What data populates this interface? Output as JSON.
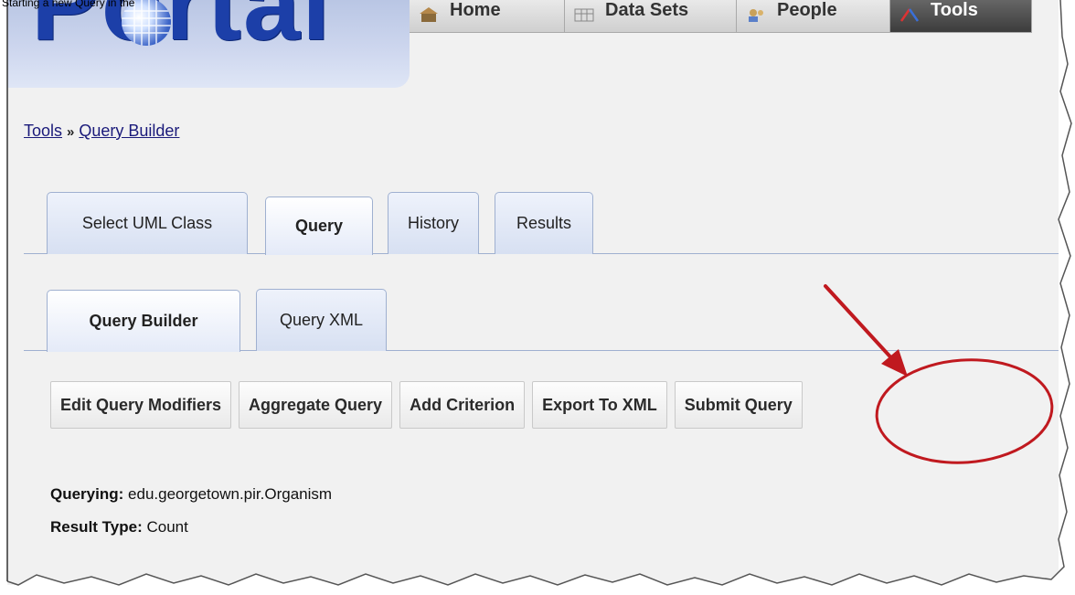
{
  "caption": "Starting a new Query in the",
  "logo": {
    "text": "Portal"
  },
  "topnav": [
    {
      "label": "Home",
      "icon": "home-icon",
      "active": false
    },
    {
      "label": "Data Sets",
      "icon": "datasets-icon",
      "active": false
    },
    {
      "label": "People",
      "icon": "people-icon",
      "active": false
    },
    {
      "label": "Tools",
      "icon": "tools-icon",
      "active": true
    }
  ],
  "breadcrumb": {
    "root": "Tools",
    "separator": "»",
    "current": "Query Builder"
  },
  "main_tabs": [
    {
      "label": "Select UML Class",
      "active": false
    },
    {
      "label": "Query",
      "active": true
    },
    {
      "label": "History",
      "active": false
    },
    {
      "label": "Results",
      "active": false
    }
  ],
  "sub_tabs": [
    {
      "label": "Query Builder",
      "active": true
    },
    {
      "label": "Query XML",
      "active": false
    }
  ],
  "toolbar": {
    "edit_modifiers": "Edit Query Modifiers",
    "aggregate": "Aggregate Query",
    "add_criterion": "Add Criterion",
    "export_xml": "Export To XML",
    "submit": "Submit Query"
  },
  "info": {
    "querying_label": "Querying:",
    "querying_value": "edu.georgetown.pir.Organism",
    "result_type_label": "Result Type:",
    "result_type_value": "Count"
  },
  "colors": {
    "annotation": "#c0191f",
    "logo_blue": "#1c3fa8",
    "tab_border": "#9fb0d0",
    "link": "#1a1a7a"
  }
}
